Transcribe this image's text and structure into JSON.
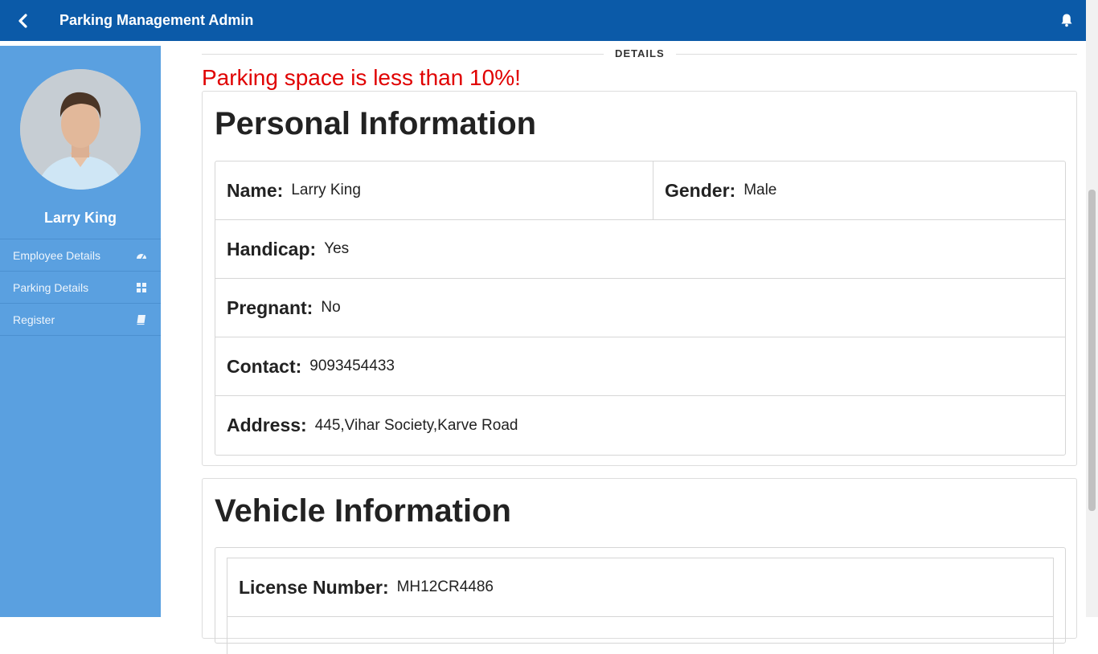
{
  "header": {
    "title": "Parking Management Admin",
    "back_icon": "chevron-left-icon",
    "notifications_icon": "bell-icon"
  },
  "sidebar": {
    "user_name": "Larry King",
    "items": [
      {
        "label": "Employee Details",
        "icon": "dashboard-icon"
      },
      {
        "label": "Parking Details",
        "icon": "grid-icon"
      },
      {
        "label": "Register",
        "icon": "book-icon"
      }
    ]
  },
  "main": {
    "section_label": "DETAILS",
    "alert": "Parking space is less than 10%!",
    "personal": {
      "heading": "Personal Information",
      "name_label": "Name:",
      "name_value": "Larry King",
      "gender_label": "Gender:",
      "gender_value": "Male",
      "handicap_label": "Handicap:",
      "handicap_value": "Yes",
      "pregnant_label": "Pregnant:",
      "pregnant_value": "No",
      "contact_label": "Contact:",
      "contact_value": "9093454433",
      "address_label": "Address:",
      "address_value": "445,Vihar Society,Karve Road"
    },
    "vehicle": {
      "heading": "Vehicle Information",
      "license_label": "License Number:",
      "license_value": "MH12CR4486"
    }
  },
  "colors": {
    "header_bg": "#0b5aa8",
    "sidebar_bg": "#5aa0e0",
    "alert": "#e00000"
  }
}
